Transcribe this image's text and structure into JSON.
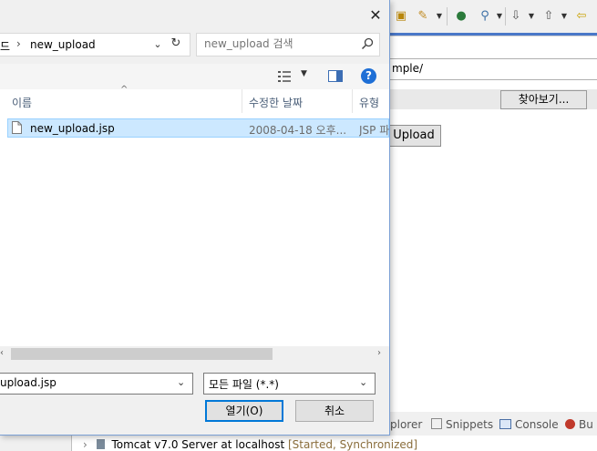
{
  "dialog": {
    "address": {
      "prefix": "드",
      "separator": "›",
      "path": "new_upload"
    },
    "search": {
      "placeholder": "new_upload 검색"
    },
    "columns": {
      "name": "이름",
      "modified": "수정한 날짜",
      "type": "유형"
    },
    "files": [
      {
        "name": "new_upload.jsp",
        "modified": "2008-04-18 오후...",
        "type": "JSP 파"
      }
    ],
    "filename_value": "upload.jsp",
    "filetype_value": "모든 파일 (*.*)",
    "open_label": "열기(O)",
    "cancel_label": "취소",
    "close_glyph": "✕"
  },
  "eclipse": {
    "url_text": "mple/",
    "browse_label": "찾아보기...",
    "upload_label": "Upload",
    "bottom_tabs": [
      {
        "label": "plorer"
      },
      {
        "label": "Snippets"
      },
      {
        "label": "Console"
      },
      {
        "label": "Bu"
      }
    ],
    "server": {
      "name": "Tomcat v7.0 Server at localhost",
      "status": "[Started, Synchronized]"
    }
  },
  "colors": {
    "selection_bg": "#cce8ff",
    "selection_border": "#99d1ff",
    "accent_blue": "#0078d7",
    "help_blue": "#1e6fd6"
  },
  "icons": {
    "close": "close-icon",
    "search": "search-icon",
    "refresh": "refresh-icon",
    "help": "help-icon",
    "file": "file-icon"
  }
}
